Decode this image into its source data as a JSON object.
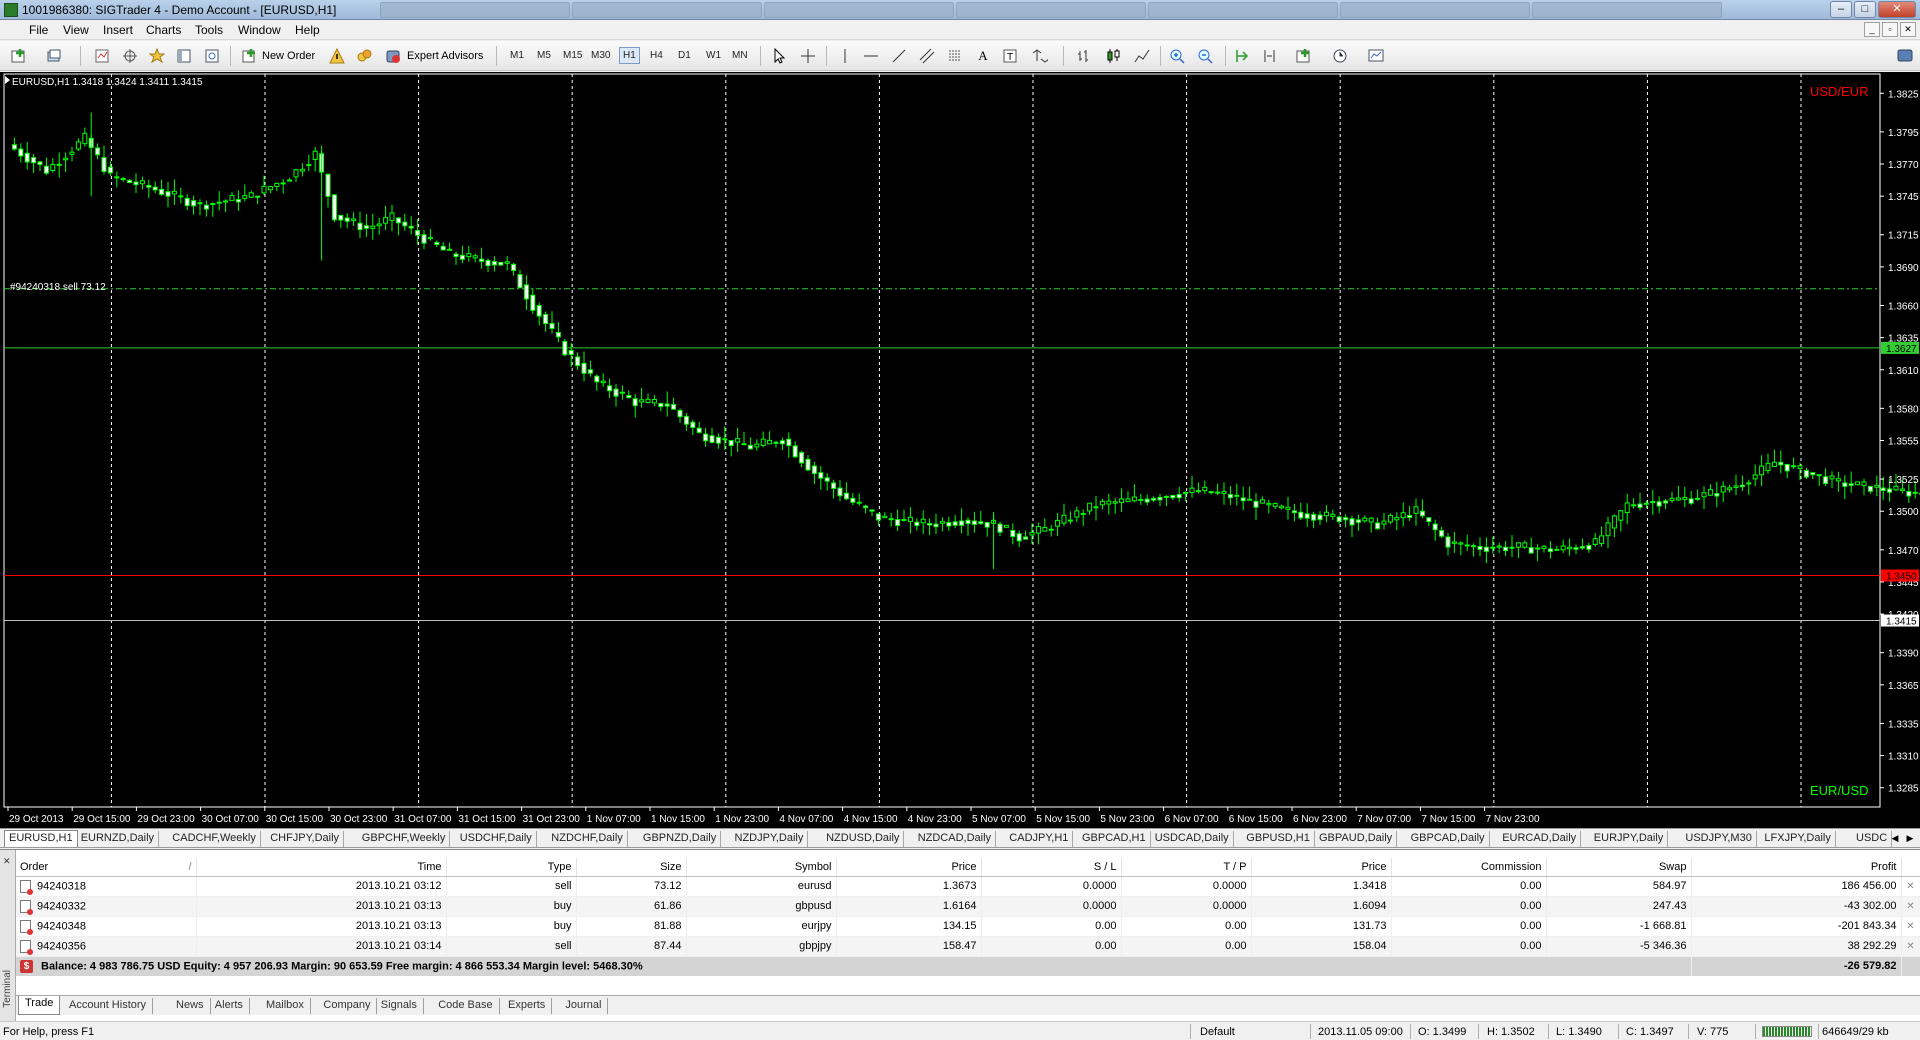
{
  "window": {
    "title": "1001986380: SIGTrader 4 - Demo Account - [EURUSD,H1]"
  },
  "menu": [
    "File",
    "View",
    "Insert",
    "Charts",
    "Tools",
    "Window",
    "Help"
  ],
  "toolbar": {
    "new_order": "New Order",
    "expert_advisors": "Expert Advisors",
    "timeframes": [
      "M1",
      "M5",
      "M15",
      "M30",
      "H1",
      "H4",
      "D1",
      "W1",
      "MN"
    ],
    "active_timeframe": "H1"
  },
  "chart": {
    "header": "EURUSD,H1  1.3418 1.3424 1.3411 1.3415",
    "label_top": "USD/EUR",
    "label_bottom": "EUR/USD",
    "order_line_label": "#94240318 sell 73.12",
    "price_ticks": [
      "1.3825",
      "1.3795",
      "1.3770",
      "1.3745",
      "1.3715",
      "1.3690",
      "1.3660",
      "1.3635",
      "1.3610",
      "1.3580",
      "1.3555",
      "1.3525",
      "1.3500",
      "1.3470",
      "1.3445",
      "1.3420",
      "1.3390",
      "1.3365",
      "1.3335",
      "1.3310",
      "1.3285"
    ],
    "price_labels": {
      "green": "1.3627",
      "red": "1.3450",
      "current": "1.3415"
    },
    "time_labels": [
      "29 Oct 2013",
      "29 Oct 15:00",
      "29 Oct 23:00",
      "30 Oct 07:00",
      "30 Oct 15:00",
      "30 Oct 23:00",
      "31 Oct 07:00",
      "31 Oct 15:00",
      "31 Oct 23:00",
      "1 Nov 07:00",
      "1 Nov 15:00",
      "1 Nov 23:00",
      "4 Nov 07:00",
      "4 Nov 15:00",
      "4 Nov 23:00",
      "5 Nov 07:00",
      "5 Nov 15:00",
      "5 Nov 23:00",
      "6 Nov 07:00",
      "6 Nov 15:00",
      "6 Nov 23:00",
      "7 Nov 07:00",
      "7 Nov 15:00",
      "7 Nov 23:00"
    ],
    "colors": {
      "bull": "#00ff00",
      "bear": "#00ff00",
      "grid": "#ffffff",
      "order_line": "#32cd32",
      "red_line": "#ff0000",
      "label_top": "#ff0000",
      "label_bottom": "#00ff00"
    }
  },
  "chart_data": {
    "type": "candlestick",
    "symbol": "EURUSD",
    "timeframe": "H1",
    "ylim": [
      1.327,
      1.384
    ],
    "x_start": "29 Oct 2013 00:00",
    "x_step_hours": 1,
    "levels": {
      "order_sell": 1.3673,
      "green_line": 1.3627,
      "red_line": 1.345,
      "bid": 1.3415
    },
    "close_path": [
      [
        0,
        1.3785
      ],
      [
        6,
        1.3765
      ],
      [
        12,
        1.379
      ],
      [
        16,
        1.376
      ],
      [
        22,
        1.3752
      ],
      [
        30,
        1.3738
      ],
      [
        38,
        1.3745
      ],
      [
        44,
        1.376
      ],
      [
        48,
        1.3778
      ],
      [
        51,
        1.373
      ],
      [
        56,
        1.372
      ],
      [
        60,
        1.3728
      ],
      [
        64,
        1.3715
      ],
      [
        69,
        1.37
      ],
      [
        74,
        1.3695
      ],
      [
        78,
        1.3692
      ],
      [
        82,
        1.366
      ],
      [
        87,
        1.3625
      ],
      [
        92,
        1.36
      ],
      [
        98,
        1.3585
      ],
      [
        103,
        1.3583
      ],
      [
        108,
        1.356
      ],
      [
        116,
        1.355
      ],
      [
        121,
        1.3556
      ],
      [
        126,
        1.353
      ],
      [
        131,
        1.351
      ],
      [
        136,
        1.3495
      ],
      [
        140,
        1.3492
      ],
      [
        144,
        1.349
      ],
      [
        149,
        1.3493
      ],
      [
        154,
        1.349
      ],
      [
        158,
        1.348
      ],
      [
        162,
        1.3486
      ],
      [
        170,
        1.3505
      ],
      [
        178,
        1.351
      ],
      [
        186,
        1.3516
      ],
      [
        190,
        1.3513
      ],
      [
        196,
        1.3505
      ],
      [
        202,
        1.3498
      ],
      [
        208,
        1.3495
      ],
      [
        214,
        1.349
      ],
      [
        220,
        1.35
      ],
      [
        225,
        1.3475
      ],
      [
        230,
        1.3472
      ],
      [
        236,
        1.3472
      ],
      [
        242,
        1.347
      ],
      [
        248,
        1.3475
      ],
      [
        253,
        1.3505
      ],
      [
        258,
        1.3508
      ],
      [
        263,
        1.351
      ],
      [
        267,
        1.3515
      ],
      [
        271,
        1.3522
      ],
      [
        276,
        1.3538
      ],
      [
        281,
        1.353
      ],
      [
        286,
        1.3522
      ],
      [
        292,
        1.3518
      ],
      [
        298,
        1.3514
      ],
      [
        304,
        1.3516
      ],
      [
        310,
        1.3518
      ],
      [
        314,
        1.3522
      ],
      [
        318,
        1.352
      ],
      [
        322,
        1.351
      ],
      [
        325,
        1.3368
      ],
      [
        328,
        1.3335
      ],
      [
        331,
        1.336
      ],
      [
        334,
        1.3375
      ],
      [
        337,
        1.3395
      ],
      [
        340,
        1.342
      ],
      [
        343,
        1.3423
      ],
      [
        346,
        1.3415
      ]
    ]
  },
  "symbol_tabs": [
    "EURUSD,H1",
    "EURNZD,Daily",
    "CADCHF,Weekly",
    "CHFJPY,Daily",
    "GBPCHF,Weekly",
    "USDCHF,Daily",
    "NZDCHF,Daily",
    "GBPNZD,Daily",
    "NZDJPY,Daily",
    "NZDUSD,Daily",
    "NZDCAD,Daily",
    "CADJPY,H1",
    "GBPCAD,H1",
    "USDCAD,Daily",
    "GBPUSD,H1",
    "GBPAUD,Daily",
    "GBPCAD,Daily",
    "EURCAD,Daily",
    "EURJPY,Daily",
    "USDJPY,M30",
    "LFXJPY,Daily",
    "USDC"
  ],
  "terminal": {
    "vertical_label": "Terminal",
    "columns": [
      "Order",
      "/",
      "Time",
      "Type",
      "Size",
      "Symbol",
      "Price",
      "S / L",
      "T / P",
      "Price",
      "Commission",
      "Swap",
      "Profit"
    ],
    "orders": [
      {
        "order": "94240318",
        "time": "2013.10.21 03:12",
        "type": "sell",
        "size": "73.12",
        "symbol": "eurusd",
        "open_price": "1.3673",
        "sl": "0.0000",
        "tp": "0.0000",
        "price": "1.3418",
        "commission": "0.00",
        "swap": "584.97",
        "profit": "186 456.00"
      },
      {
        "order": "94240332",
        "time": "2013.10.21 03:13",
        "type": "buy",
        "size": "61.86",
        "symbol": "gbpusd",
        "open_price": "1.6164",
        "sl": "0.0000",
        "tp": "0.0000",
        "price": "1.6094",
        "commission": "0.00",
        "swap": "247.43",
        "profit": "-43 302.00"
      },
      {
        "order": "94240348",
        "time": "2013.10.21 03:13",
        "type": "buy",
        "size": "81.88",
        "symbol": "eurjpy",
        "open_price": "134.15",
        "sl": "0.00",
        "tp": "0.00",
        "price": "131.73",
        "commission": "0.00",
        "swap": "-1 668.81",
        "profit": "-201 843.34"
      },
      {
        "order": "94240356",
        "time": "2013.10.21 03:14",
        "type": "sell",
        "size": "87.44",
        "symbol": "gbpjpy",
        "open_price": "158.47",
        "sl": "0.00",
        "tp": "0.00",
        "price": "158.04",
        "commission": "0.00",
        "swap": "-5 346.36",
        "profit": "38 292.29"
      }
    ],
    "balance_text": "Balance: 4 983 786.75 USD  Equity: 4 957 206.93  Margin: 90 653.59  Free margin: 4 866 553.34  Margin level: 5468.30%",
    "balance_profit": "-26 579.82",
    "tabs": [
      "Trade",
      "Account History",
      "News",
      "Alerts",
      "Mailbox",
      "Company",
      "Signals",
      "Code Base",
      "Experts",
      "Journal"
    ],
    "active_tab": "Trade"
  },
  "status": {
    "help": "For Help, press F1",
    "profile": "Default",
    "datetime": "2013.11.05 09:00",
    "open": "O: 1.3499",
    "high": "H: 1.3502",
    "low": "L: 1.3490",
    "close": "C: 1.3497",
    "volume": "V: 775",
    "traffic": "646649/29 kb"
  }
}
